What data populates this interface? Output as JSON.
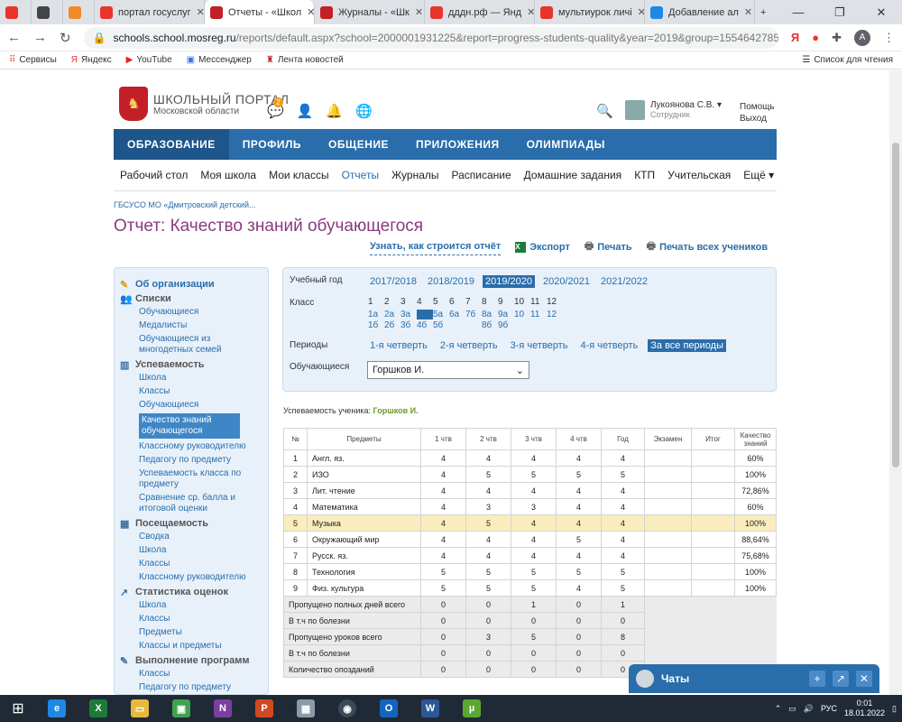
{
  "browser": {
    "tabs": [
      {
        "label": "",
        "icon": "yandex-icon",
        "color": "#e8342c",
        "kind": "small"
      },
      {
        "label": "",
        "icon": "mortarboard-icon",
        "color": "#444444",
        "kind": "small"
      },
      {
        "label": "",
        "icon": "tab-app-icon",
        "color": "#f08a24",
        "kind": "small"
      },
      {
        "label": "портал госуслуг",
        "icon": "yandex-icon",
        "color": "#e8342c",
        "kind": "mid"
      },
      {
        "label": "Отчеты - «Школ",
        "icon": "school-portal-icon",
        "color": "#c21f26",
        "kind": "active"
      },
      {
        "label": "Журналы - «Шк",
        "icon": "school-portal-icon",
        "color": "#c21f26",
        "kind": "mid"
      },
      {
        "label": "дддн.рф — Янд",
        "icon": "yandex-icon",
        "color": "#e8342c",
        "kind": "mid"
      },
      {
        "label": "мультиурок личі",
        "icon": "yandex-icon",
        "color": "#e8342c",
        "kind": "mid"
      },
      {
        "label": "Добавление ал",
        "icon": "book-icon",
        "color": "#1e88e5",
        "kind": "mid"
      }
    ],
    "new_tab": "+",
    "url_host": "schools.school.mosreg.ru",
    "url_path": "/reports/default.aspx?school=2000001931225&report=progress-students-quality&year=2019&group=155464278569...",
    "profile_letter": "A",
    "bookmarks": [
      {
        "label": "Сервисы",
        "icon": "apps-grid-icon"
      },
      {
        "label": "Яндекс",
        "icon": "yandex-icon"
      },
      {
        "label": "YouTube",
        "icon": "youtube-icon"
      },
      {
        "label": "Мессенджер",
        "icon": "messenger-icon"
      },
      {
        "label": "Лента новостей",
        "icon": "school-portal-icon"
      }
    ],
    "reading_list": "Список для чтения"
  },
  "portal": {
    "logo_title": "ШКОЛЬНЫЙ ПОРТАЛ",
    "logo_sub": "Московской области",
    "notif_count": "2",
    "user_name": "Лукоянова С.В.",
    "user_role": "Сотрудник",
    "help": "Помощь",
    "logout": "Выход",
    "main_nav": [
      "ОБРАЗОВАНИЕ",
      "ПРОФИЛЬ",
      "ОБЩЕНИЕ",
      "ПРИЛОЖЕНИЯ",
      "ОЛИМПИАДЫ"
    ],
    "sub_nav": [
      "Рабочий стол",
      "Моя школа",
      "Мои классы",
      "Отчеты",
      "Журналы",
      "Расписание",
      "Домашние задания",
      "КТП",
      "Учительская",
      "Ещё ▾"
    ],
    "breadcrumb": "ГБСУСО МО «Дмитровский детский...",
    "page_title": "Отчет: Качество знаний обучающегося",
    "action_how": "Узнать, как строится отчёт",
    "action_export": "Экспорт",
    "action_print": "Печать",
    "action_print_all": "Печать всех учеников"
  },
  "sidebar": {
    "org": "Об организации",
    "groups": [
      {
        "title": "Списки",
        "icon": "people-icon",
        "items": [
          "Обучающиеся",
          "Медалисты",
          "Обучающиеся из многодетных семей"
        ]
      },
      {
        "title": "Успеваемость",
        "icon": "bar-chart-icon",
        "items": [
          "Школа",
          "Классы",
          "Обучающиеся",
          "Качество знаний обучающегося",
          "Классному руководителю",
          "Педагогу по предмету",
          "Успеваемость класса по предмету",
          "Сравнение ср. балла и итоговой оценки"
        ]
      },
      {
        "title": "Посещаемость",
        "icon": "calendar-icon",
        "items": [
          "Сводка",
          "Школа",
          "Классы",
          "Классному руководителю"
        ]
      },
      {
        "title": "Статистика оценок",
        "icon": "stats-icon",
        "items": [
          "Школа",
          "Классы",
          "Предметы",
          "Классы и предметы"
        ]
      },
      {
        "title": "Выполнение программ",
        "icon": "program-icon",
        "items": [
          "Классы",
          "Педагогу по предмету"
        ]
      }
    ]
  },
  "filters": {
    "year_label": "Учебный год",
    "years": [
      "2017/2018",
      "2018/2019",
      "2019/2020",
      "2020/2021",
      "2021/2022"
    ],
    "class_label": "Класс",
    "class_nums": [
      "1",
      "2",
      "3",
      "4",
      "5",
      "6",
      "7",
      "8",
      "9",
      "10",
      "11",
      "12"
    ],
    "class_row_a": [
      "1а",
      "2а",
      "3а",
      "4а",
      "5а",
      "6а",
      "7б",
      "8а",
      "9а",
      "10",
      "11",
      "12"
    ],
    "class_row_b": [
      "1б",
      "2б",
      "3б",
      "4б",
      "5б",
      "",
      "",
      "8б",
      "9б",
      "",
      "",
      ""
    ],
    "periods_label": "Периоды",
    "periods": [
      "1-я четверть",
      "2-я четверть",
      "3-я четверть",
      "4-я четверть",
      "За все периоды"
    ],
    "student_label": "Обучающиеся",
    "student_value": "Горшков И."
  },
  "report": {
    "student_caption": "Успеваемость ученика:",
    "student_name": "Горшков И.",
    "headers": [
      "№",
      "Предметы",
      "1 чтв",
      "2 чтв",
      "3 чтв",
      "4 чтв",
      "Год",
      "Экзамен",
      "Итог",
      "Качество знаний"
    ],
    "rows": [
      [
        "1",
        "Англ. яз.",
        "4",
        "4",
        "4",
        "4",
        "4",
        "",
        "",
        "60%"
      ],
      [
        "2",
        "ИЗО",
        "4",
        "5",
        "5",
        "5",
        "5",
        "",
        "",
        "100%"
      ],
      [
        "3",
        "Лит. чтение",
        "4",
        "4",
        "4",
        "4",
        "4",
        "",
        "",
        "72,86%"
      ],
      [
        "4",
        "Математика",
        "4",
        "3",
        "3",
        "4",
        "4",
        "",
        "",
        "60%"
      ],
      [
        "5",
        "Музыка",
        "4",
        "5",
        "4",
        "4",
        "4",
        "",
        "",
        "100%"
      ],
      [
        "6",
        "Окружающий мир",
        "4",
        "4",
        "4",
        "5",
        "4",
        "",
        "",
        "88,64%"
      ],
      [
        "7",
        "Русск. яз.",
        "4",
        "4",
        "4",
        "4",
        "4",
        "",
        "",
        "75,68%"
      ],
      [
        "8",
        "Технология",
        "5",
        "5",
        "5",
        "5",
        "5",
        "",
        "",
        "100%"
      ],
      [
        "9",
        "Физ. культура",
        "5",
        "5",
        "5",
        "4",
        "5",
        "",
        "",
        "100%"
      ]
    ],
    "footer": [
      [
        "Пропущено полных дней всего",
        "0",
        "0",
        "1",
        "0",
        "1"
      ],
      [
        "В т.ч по болезни",
        "0",
        "0",
        "0",
        "0",
        "0"
      ],
      [
        "Пропущено уроков всего",
        "0",
        "3",
        "5",
        "0",
        "8"
      ],
      [
        "В т.ч по болезни",
        "0",
        "0",
        "0",
        "0",
        "0"
      ],
      [
        "Количество опозданий",
        "0",
        "0",
        "0",
        "0",
        "0"
      ]
    ]
  },
  "chat": {
    "title": "Чаты"
  },
  "taskbar": {
    "lang": "РУС",
    "time": "0:01",
    "date": "18.01.2022"
  }
}
